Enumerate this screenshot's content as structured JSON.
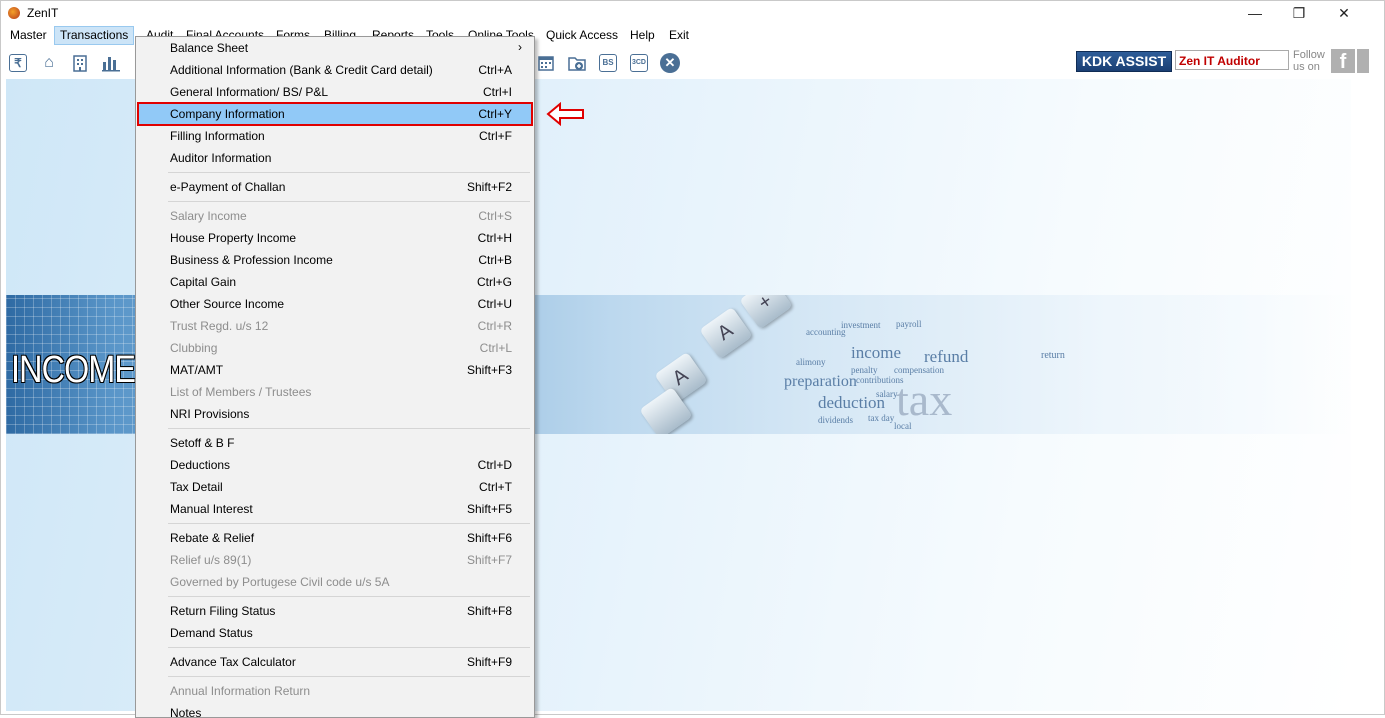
{
  "window": {
    "title": "ZenIT"
  },
  "menubar": {
    "items": [
      "Master",
      "Transactions",
      "Audit",
      "Final Accounts",
      "Forms",
      "Billing",
      "Reports",
      "Tools",
      "Online Tools",
      "Quick Access",
      "Help",
      "Exit"
    ]
  },
  "toolbar": {
    "kdk_label": "KDK ASSIST",
    "zen_label": "Zen IT Auditor",
    "follow_line1": "Follow",
    "follow_line2": "us on",
    "icons": [
      "rupee-icon",
      "home-icon",
      "building-icon",
      "bar-chart-icon",
      "calendar-icon",
      "folder-add-icon",
      "bs-icon",
      "3cd-icon",
      "close-icon"
    ],
    "bs_text": "BS",
    "cd_text": "3CD"
  },
  "banner": {
    "income_text": "INCOME",
    "words": [
      "income",
      "refund",
      "preparation",
      "deduction",
      "tax",
      "salary",
      "payroll",
      "dividends",
      "contributions",
      "penalty",
      "compensation",
      "return",
      "investment",
      "alimony",
      "accounting",
      "tax day",
      "local"
    ]
  },
  "dropdown": {
    "items": [
      {
        "label": "Balance Sheet",
        "shortcut": "",
        "submenu": true,
        "disabled": false
      },
      {
        "label": "Additional Information (Bank & Credit Card detail)",
        "shortcut": "Ctrl+A",
        "disabled": false
      },
      {
        "label": "General Information/ BS/ P&L",
        "shortcut": "Ctrl+I",
        "disabled": false
      },
      {
        "label": "Company Information",
        "shortcut": "Ctrl+Y",
        "disabled": false,
        "highlighted": true
      },
      {
        "label": "Filling Information",
        "shortcut": "Ctrl+F",
        "disabled": false
      },
      {
        "label": "Auditor Information",
        "shortcut": "",
        "disabled": false
      },
      {
        "label": "e-Payment of Challan",
        "shortcut": "Shift+F2",
        "disabled": false
      },
      {
        "label": "Salary Income",
        "shortcut": "Ctrl+S",
        "disabled": true
      },
      {
        "label": "House Property Income",
        "shortcut": "Ctrl+H",
        "disabled": false
      },
      {
        "label": "Business & Profession Income",
        "shortcut": "Ctrl+B",
        "disabled": false
      },
      {
        "label": "Capital Gain",
        "shortcut": "Ctrl+G",
        "disabled": false
      },
      {
        "label": "Other Source Income",
        "shortcut": "Ctrl+U",
        "disabled": false
      },
      {
        "label": "Trust Regd. u/s 12",
        "shortcut": "Ctrl+R",
        "disabled": true
      },
      {
        "label": "Clubbing",
        "shortcut": "Ctrl+L",
        "disabled": true
      },
      {
        "label": "MAT/AMT",
        "shortcut": "Shift+F3",
        "disabled": false
      },
      {
        "label": "List of Members / Trustees",
        "shortcut": "",
        "disabled": true
      },
      {
        "label": "NRI Provisions",
        "shortcut": "",
        "disabled": false
      },
      {
        "label": "Setoff & B F",
        "shortcut": "",
        "disabled": false
      },
      {
        "label": "Deductions",
        "shortcut": "Ctrl+D",
        "disabled": false
      },
      {
        "label": "Tax Detail",
        "shortcut": "Ctrl+T",
        "disabled": false
      },
      {
        "label": "Manual Interest",
        "shortcut": "Shift+F5",
        "disabled": false
      },
      {
        "label": "Rebate & Relief",
        "shortcut": "Shift+F6",
        "disabled": false
      },
      {
        "label": "Relief u/s 89(1)",
        "shortcut": "Shift+F7",
        "disabled": true
      },
      {
        "label": "Governed by Portugese Civil code u/s 5A",
        "shortcut": "",
        "disabled": true
      },
      {
        "label": "Return Filing Status",
        "shortcut": "Shift+F8",
        "disabled": false
      },
      {
        "label": "Demand Status",
        "shortcut": "",
        "disabled": false
      },
      {
        "label": "Advance Tax Calculator",
        "shortcut": "Shift+F9",
        "disabled": false
      },
      {
        "label": "Annual Information Return",
        "shortcut": "",
        "disabled": true
      },
      {
        "label": "Notes",
        "shortcut": "",
        "disabled": false
      }
    ]
  },
  "colors": {
    "highlight": "#91c9f7",
    "callout": "#e00000",
    "kdk": "#1b3f73",
    "zen_text": "#c00000"
  }
}
